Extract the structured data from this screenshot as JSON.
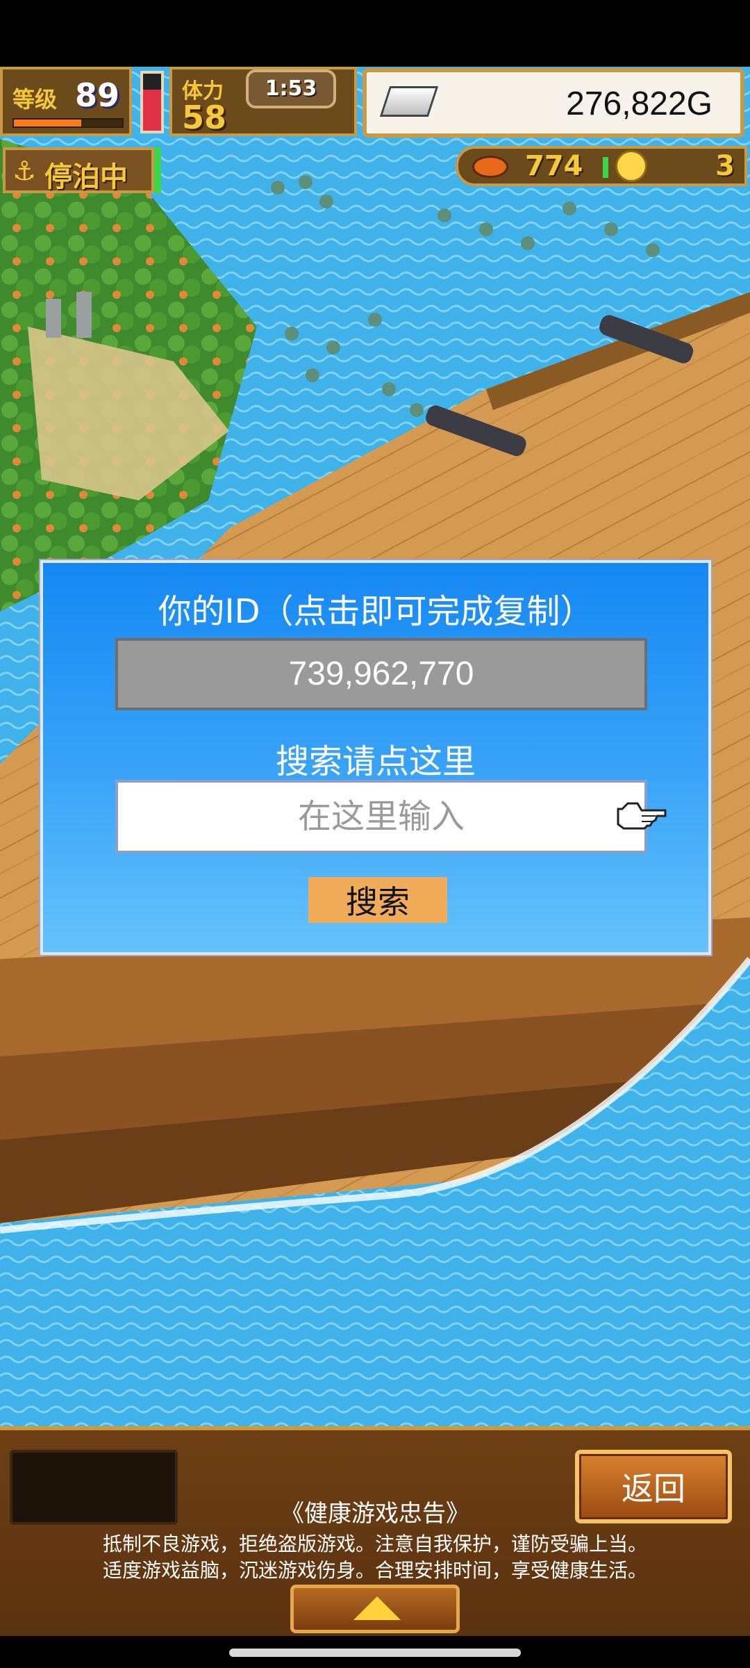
{
  "hud": {
    "level_label": "等级",
    "level": "89",
    "exp_progress": 0.62,
    "stamina_gauge_level": 0.72,
    "stamina_label": "体力",
    "stamina": "58",
    "timer": "1:53",
    "gold": "276,822G",
    "status": "停泊中",
    "resource_count": "774",
    "coin_count": "3"
  },
  "dialog": {
    "title": "你的ID（点击即可完成复制）",
    "player_id": "739,962,770",
    "search_prompt": "搜索请点这里",
    "search_placeholder": "在这里输入",
    "search_button": "搜索"
  },
  "bottom": {
    "back_button": "返回",
    "notice_title": "《健康游戏忠告》",
    "notice_line1": "抵制不良游戏，拒绝盗版游戏。注意自我保护，谨防受骗上当。",
    "notice_line2": "适度游戏益脑，沉迷游戏伤身。合理安排时间，享受健康生活。"
  },
  "colors": {
    "dialog_top": "#1588f2",
    "dialog_bottom": "#66c2fb",
    "search_button": "#f1ac5a",
    "hud_gold_text": "#f7c83a"
  }
}
